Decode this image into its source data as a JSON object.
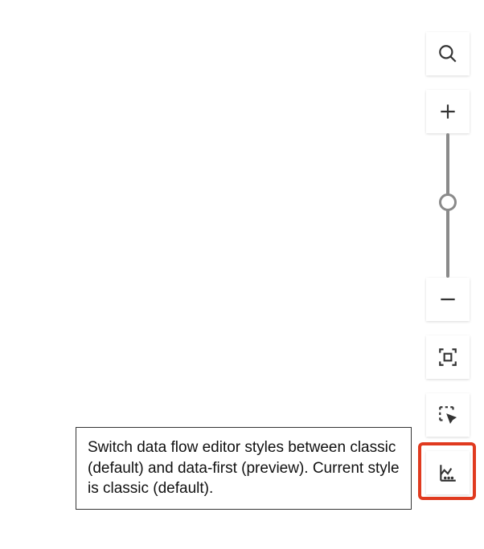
{
  "tooltip": {
    "text": "Switch data flow editor styles between classic (default) and data-first (preview). Current style is classic (default)."
  },
  "toolbar": {
    "search": "search-icon",
    "zoom_in": "plus-icon",
    "zoom_out": "minus-icon",
    "fit": "fit-to-screen-icon",
    "select": "selection-cursor-icon",
    "style": "chart-style-icon"
  }
}
